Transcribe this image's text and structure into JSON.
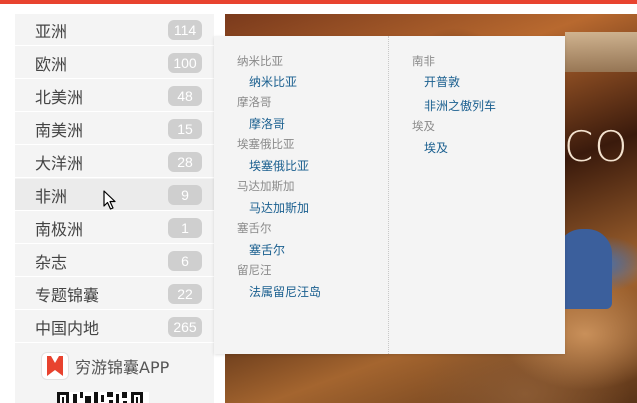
{
  "sidebar": {
    "items": [
      {
        "label": "亚洲",
        "count": "114"
      },
      {
        "label": "欧洲",
        "count": "100"
      },
      {
        "label": "北美洲",
        "count": "48"
      },
      {
        "label": "南美洲",
        "count": "15"
      },
      {
        "label": "大洋洲",
        "count": "28"
      },
      {
        "label": "非洲",
        "count": "9"
      },
      {
        "label": "南极洲",
        "count": "1"
      },
      {
        "label": "杂志",
        "count": "6"
      },
      {
        "label": "专题锦囊",
        "count": "22"
      },
      {
        "label": "中国内地",
        "count": "265"
      }
    ],
    "active_index": 5,
    "app_label": "穷游锦囊APP"
  },
  "dropdown": {
    "col1": [
      {
        "region": "纳米比亚",
        "cities": [
          "纳米比亚"
        ]
      },
      {
        "region": "摩洛哥",
        "cities": [
          "摩洛哥"
        ]
      },
      {
        "region": "埃塞俄比亚",
        "cities": [
          "埃塞俄比亚"
        ]
      },
      {
        "region": "马达加斯加",
        "cities": [
          "马达加斯加"
        ]
      },
      {
        "region": "塞舌尔",
        "cities": [
          "塞舌尔"
        ]
      },
      {
        "region": "留尼汪",
        "cities": [
          "法属留尼汪岛"
        ]
      }
    ],
    "col2": [
      {
        "region": "南非",
        "cities": [
          "开普敦",
          "非洲之傲列车"
        ]
      },
      {
        "region": "埃及",
        "cities": [
          "埃及"
        ]
      }
    ]
  },
  "background": {
    "overlay_text": "CO"
  },
  "colors": {
    "accent": "#e8432f",
    "link": "#1a5f8f",
    "badge": "#cfcfcf",
    "sidebar_bg": "#f4f4f4"
  },
  "icons": {
    "app_logo": "bookmark-logo-icon",
    "cursor": "mouse-pointer-icon"
  }
}
